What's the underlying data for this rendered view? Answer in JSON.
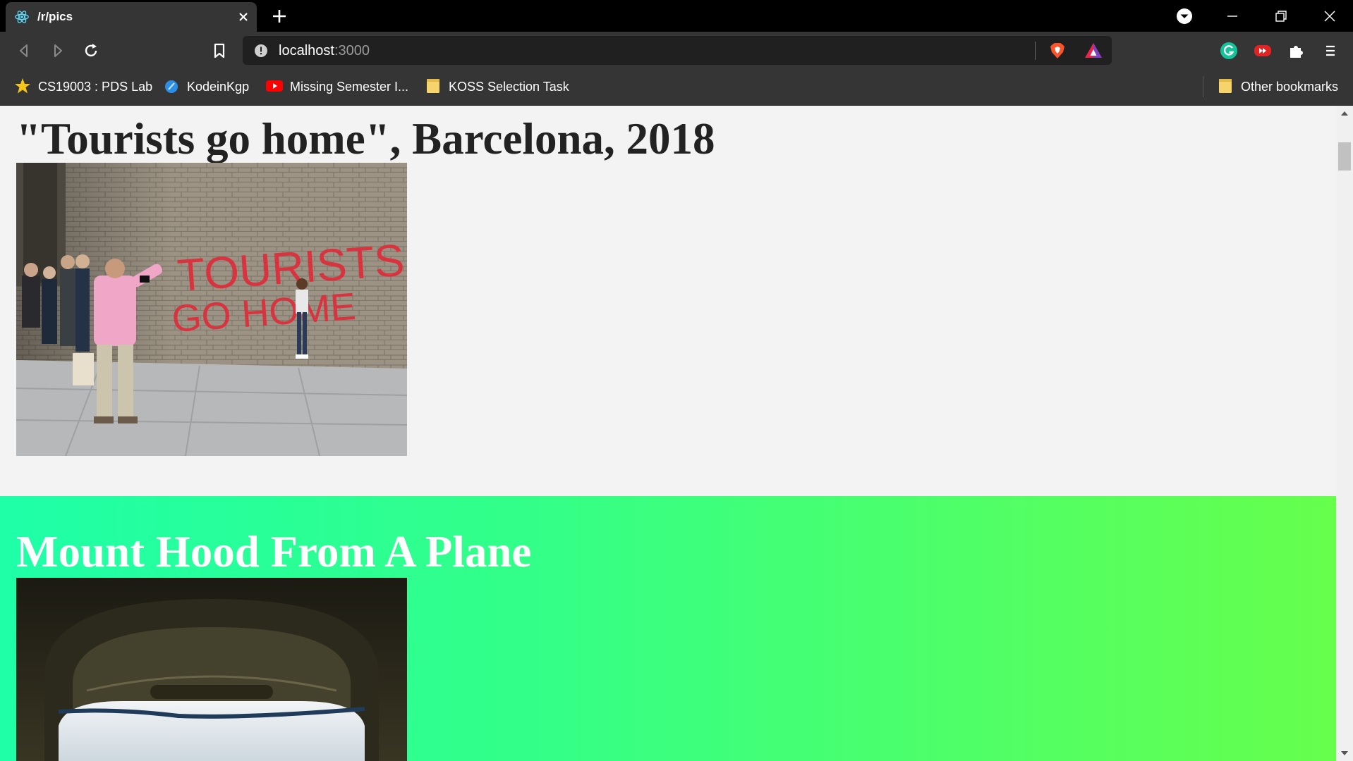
{
  "browser": {
    "tab_title": "/r/pics",
    "url_host": "localhost",
    "url_port": ":3000",
    "bookmarks": [
      {
        "label": "CS19003 : PDS Lab",
        "icon": "star-icon"
      },
      {
        "label": "KodeinKgp",
        "icon": "kodein-icon"
      },
      {
        "label": "Missing Semester I...",
        "icon": "youtube-icon"
      },
      {
        "label": "KOSS Selection Task",
        "icon": "folder-icon"
      }
    ],
    "other_bookmarks": "Other bookmarks"
  },
  "posts": [
    {
      "title": "\"Tourists go home\", Barcelona, 2018",
      "graffiti": [
        "TOURISTS",
        "GO HOME"
      ]
    },
    {
      "title": "Mount Hood From A Plane"
    }
  ],
  "colors": {
    "accent_gradient_start": "#1effa8",
    "accent_gradient_end": "#66ff4c",
    "graffiti_red": "#d8333f"
  }
}
